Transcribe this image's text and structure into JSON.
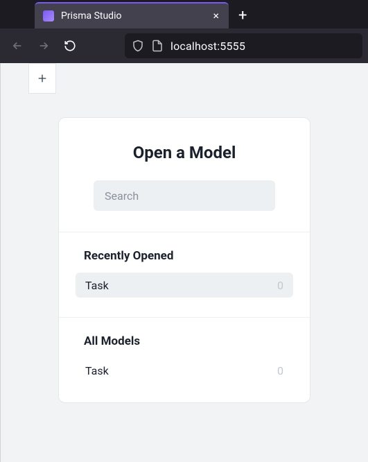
{
  "browser": {
    "tab_title": "Prisma Studio",
    "new_tab_label": "+",
    "close_tab_label": "×",
    "url": "localhost:5555"
  },
  "page": {
    "add_tab_label": "+"
  },
  "modal": {
    "title": "Open a Model",
    "search_placeholder": "Search",
    "recent": {
      "heading": "Recently Opened",
      "items": [
        {
          "name": "Task",
          "count": "0"
        }
      ]
    },
    "all": {
      "heading": "All Models",
      "items": [
        {
          "name": "Task",
          "count": "0"
        }
      ]
    }
  }
}
